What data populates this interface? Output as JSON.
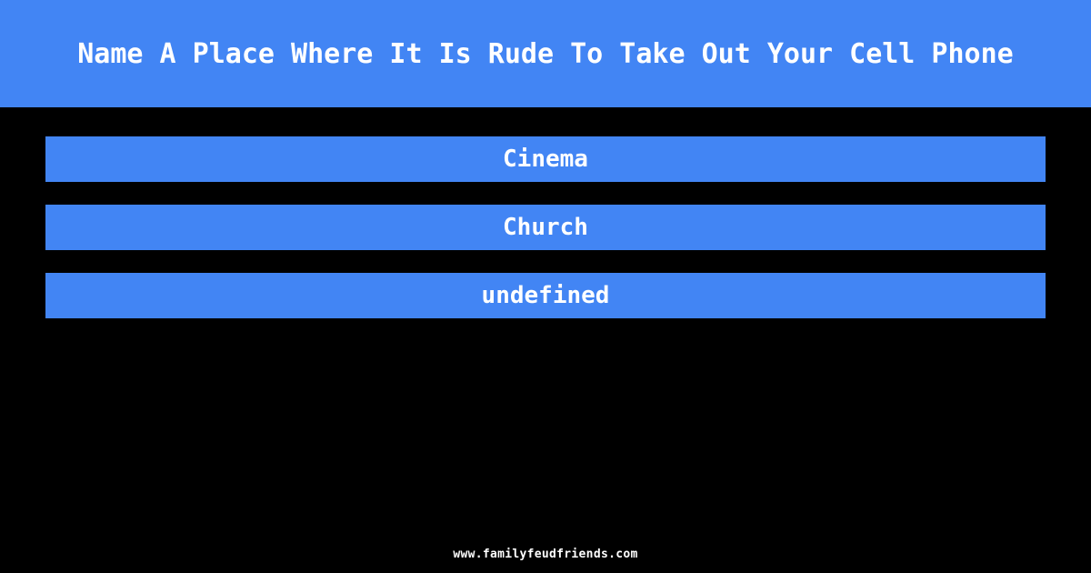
{
  "colors": {
    "background": "#000000",
    "accent": "#4285f4",
    "text": "#ffffff"
  },
  "header": {
    "question": "Name A Place Where It Is Rude To Take Out Your Cell Phone"
  },
  "answers": [
    {
      "label": "Cinema"
    },
    {
      "label": "Church"
    },
    {
      "label": "undefined"
    }
  ],
  "footer": {
    "site_url": "www.familyfeudfriends.com"
  }
}
